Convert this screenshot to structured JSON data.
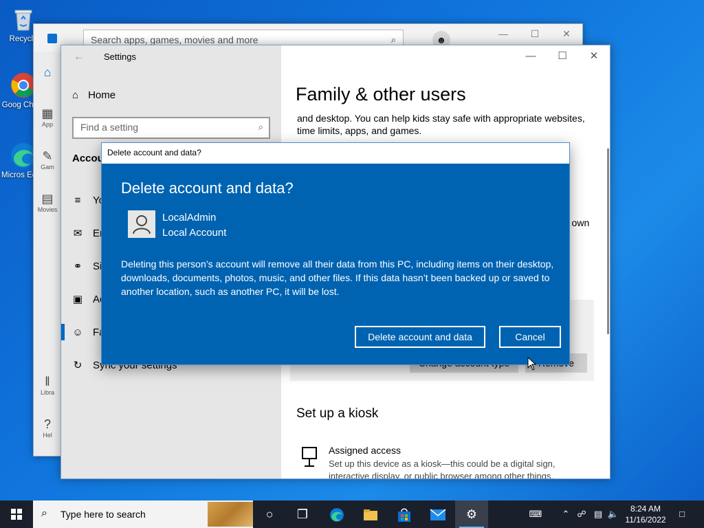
{
  "desktop": {
    "icons": [
      {
        "label": "Recycle",
        "icon": "recycle-bin-icon"
      },
      {
        "label": "Goog Chron",
        "icon": "chrome-icon"
      },
      {
        "label": "Micros Edge",
        "icon": "edge-icon"
      }
    ]
  },
  "store": {
    "search_placeholder": "Search apps, games, movies and more",
    "sidebar": [
      "App",
      "Gam",
      "Movies",
      "Libra",
      "Hel"
    ]
  },
  "settings": {
    "title": "Settings",
    "home": "Home",
    "find_placeholder": "Find a setting",
    "section": "Accoun",
    "nav": [
      {
        "label": "Yo",
        "icon": "your-info-icon"
      },
      {
        "label": "Em",
        "icon": "email-icon"
      },
      {
        "label": "Si",
        "icon": "sign-in-key-icon"
      },
      {
        "label": "Ac",
        "icon": "access-work-icon"
      },
      {
        "label": "Fa",
        "icon": "family-icon"
      },
      {
        "label": "Sync your settings",
        "icon": "sync-icon"
      }
    ],
    "right": {
      "heading": "Family & other users",
      "paragraph": "and desktop. You can help kids stay safe with appropriate websites, time limits, apps, and games.",
      "own": "r own",
      "change_type_btn": "Change account type",
      "remove_btn": "Remove",
      "kiosk_heading": "Set up a kiosk",
      "assigned_title": "Assigned access",
      "assigned_desc": "Set up this device as a kiosk—this could be a digital sign, interactive display, or public browser among other things."
    }
  },
  "dialog": {
    "titlebar": "Delete account and data?",
    "heading": "Delete account and data?",
    "account_name": "LocalAdmin",
    "account_type": "Local Account",
    "message": "Deleting this person’s account will remove all their data from this PC, including items on their desktop, downloads, documents, photos, music, and other files. If this data hasn’t been backed up or saved to another location, such as another PC, it will be lost.",
    "delete_btn": "Delete account and data",
    "cancel_btn": "Cancel"
  },
  "taskbar": {
    "search_placeholder": "Type here to search",
    "time": "8:24 AM",
    "date": "11/16/2022"
  },
  "colors": {
    "dialog_bg": "#0063b1",
    "accent": "#0067c0",
    "taskbar": "#1a1f2c"
  }
}
